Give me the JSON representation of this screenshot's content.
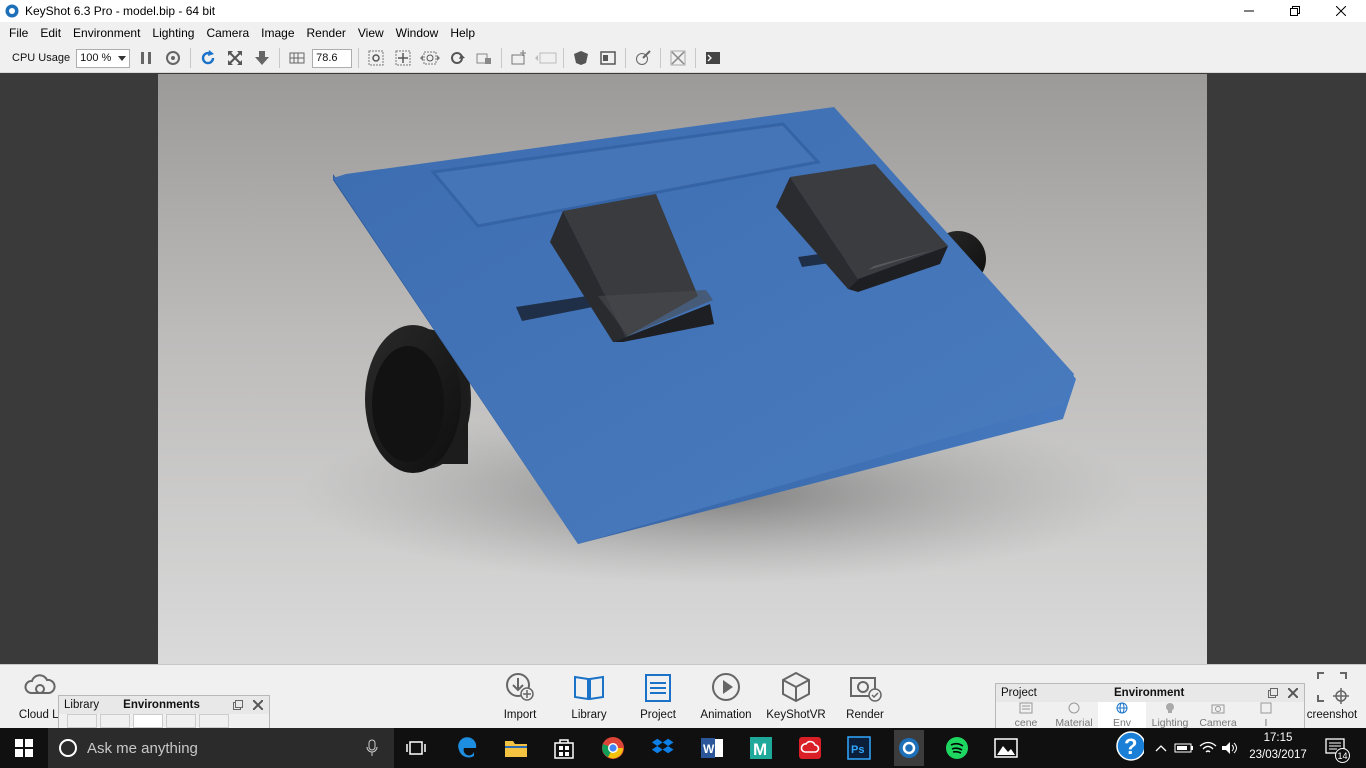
{
  "window": {
    "title": "KeyShot 6.3 Pro  - model.bip  - 64 bit"
  },
  "menu": [
    "File",
    "Edit",
    "Environment",
    "Lighting",
    "Camera",
    "Image",
    "Render",
    "View",
    "Window",
    "Help"
  ],
  "toolbar": {
    "cpu_label": "CPU Usage",
    "cpu_value": "100 %",
    "fov_value": "78.6"
  },
  "ribbon": {
    "cloud_label": "Cloud Li",
    "import": "Import",
    "library": "Library",
    "project": "Project",
    "animation": "Animation",
    "keyshotvr": "KeyShotVR",
    "render": "Render",
    "screenshot": "creenshot"
  },
  "library_panel": {
    "tab_library": "Library",
    "tab_environments": "Environments"
  },
  "project_panel": {
    "tab_project": "Project",
    "tab_environment": "Environment",
    "tabs": [
      "cene",
      "Material",
      "Env",
      "Lighting",
      "Camera",
      "I"
    ]
  },
  "taskbar": {
    "search_placeholder": "Ask me anything",
    "time": "17:15",
    "date": "23/03/2017",
    "notifications": "14"
  },
  "colors": {
    "accent_blue": "#1a73c8",
    "model_blue": "#3f6fb3"
  }
}
